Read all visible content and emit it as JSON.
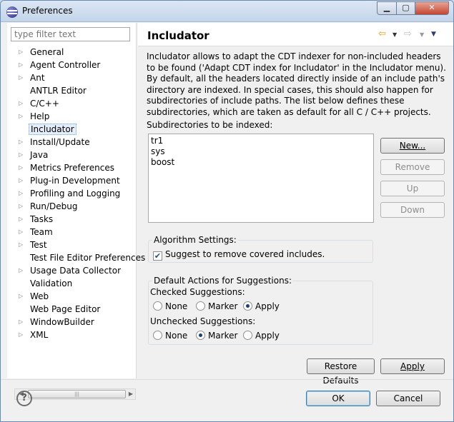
{
  "window": {
    "title": "Preferences"
  },
  "filter": {
    "placeholder": "type filter text"
  },
  "tree": [
    {
      "label": "General",
      "expandable": true
    },
    {
      "label": "Agent Controller",
      "expandable": true
    },
    {
      "label": "Ant",
      "expandable": true
    },
    {
      "label": "ANTLR Editor",
      "expandable": false
    },
    {
      "label": "C/C++",
      "expandable": true
    },
    {
      "label": "Help",
      "expandable": true
    },
    {
      "label": "Includator",
      "expandable": false,
      "selected": true
    },
    {
      "label": "Install/Update",
      "expandable": true
    },
    {
      "label": "Java",
      "expandable": true
    },
    {
      "label": "Metrics Preferences",
      "expandable": true
    },
    {
      "label": "Plug-in Development",
      "expandable": true
    },
    {
      "label": "Profiling and Logging",
      "expandable": true
    },
    {
      "label": "Run/Debug",
      "expandable": true
    },
    {
      "label": "Tasks",
      "expandable": true
    },
    {
      "label": "Team",
      "expandable": true
    },
    {
      "label": "Test",
      "expandable": true
    },
    {
      "label": "Test File Editor Preferences",
      "expandable": false
    },
    {
      "label": "Usage Data Collector",
      "expandable": true
    },
    {
      "label": "Validation",
      "expandable": false
    },
    {
      "label": "Web",
      "expandable": true
    },
    {
      "label": "Web Page Editor",
      "expandable": false
    },
    {
      "label": "WindowBuilder",
      "expandable": true
    },
    {
      "label": "XML",
      "expandable": true
    }
  ],
  "page": {
    "title": "Includator",
    "description": "Includator allows to adapt the CDT indexer for non-included headers to be found ('Adapt CDT index for Includator' in the Includator menu). By default, all the headers located directly inside of an include path's directory are indexed. In special cases, this should also happen for subdirectories of include paths. The list below defines these subdirectories, which are taken as default for all C / C++ projects.",
    "subdirs_label": "Subdirectories to be indexed:",
    "subdirs": [
      "tr1",
      "sys",
      "boost"
    ],
    "buttons": {
      "new": "New...",
      "remove": "Remove",
      "up": "Up",
      "down": "Down"
    },
    "algorithm": {
      "title": "Algorithm Settings:",
      "suggest_label": "Suggest to remove covered includes.",
      "suggest_checked": true
    },
    "defaults": {
      "title": "Default Actions for Suggestions:",
      "checked_label": "Checked Suggestions:",
      "checked_options": [
        "None",
        "Marker",
        "Apply"
      ],
      "checked_selected": "Apply",
      "unchecked_label": "Unchecked Suggestions:",
      "unchecked_options": [
        "None",
        "Marker",
        "Apply"
      ],
      "unchecked_selected": "Marker"
    },
    "restore_label": "Restore Defaults",
    "apply_label": "Apply"
  },
  "footer": {
    "ok_label": "OK",
    "cancel_label": "Cancel"
  },
  "icons": {
    "back": "back-arrow-icon",
    "forward": "forward-arrow-icon",
    "menu": "view-menu-icon",
    "help": "help-icon"
  }
}
